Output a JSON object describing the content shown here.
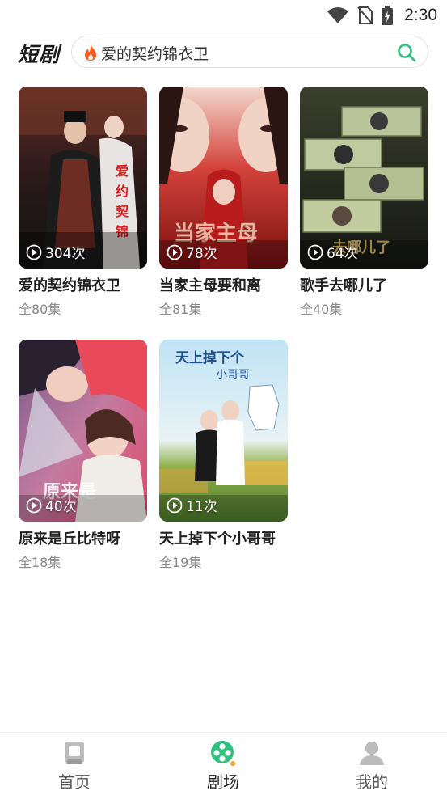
{
  "status_bar": {
    "time": "2:30"
  },
  "header": {
    "brand": "短剧",
    "search_text": "爱的契约锦衣卫"
  },
  "dramas": [
    {
      "title": "爱的契约锦衣卫",
      "views": "304次",
      "episodes": "全80集"
    },
    {
      "title": "当家主母要和离",
      "views": "78次",
      "episodes": "全81集"
    },
    {
      "title": "歌手去哪儿了",
      "views": "64次",
      "episodes": "全40集"
    },
    {
      "title": "原来是丘比特呀",
      "views": "40次",
      "episodes": "全18集"
    },
    {
      "title": "天上掉下个小哥哥",
      "views": "11次",
      "episodes": "全19集"
    }
  ],
  "nav": [
    {
      "label": "首页",
      "icon": "home-icon"
    },
    {
      "label": "剧场",
      "icon": "theater-icon",
      "active": true
    },
    {
      "label": "我的",
      "icon": "profile-icon"
    }
  ],
  "colors": {
    "accent": "#2ec27e",
    "fire": "#ff5a1f",
    "text": "#1f1f1f",
    "muted": "#888888"
  }
}
